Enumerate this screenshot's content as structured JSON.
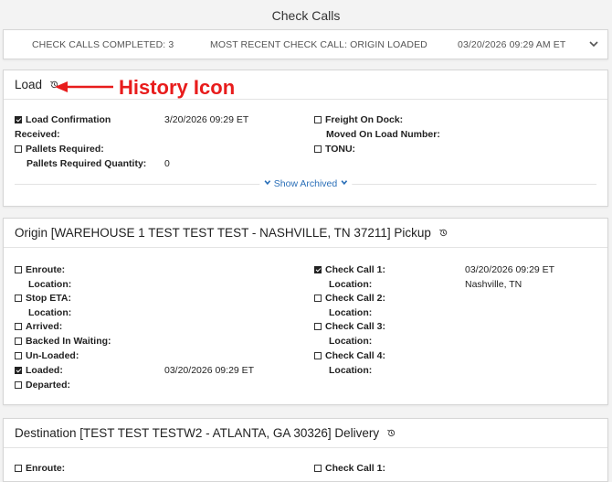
{
  "page": {
    "title": "Check Calls"
  },
  "summary": {
    "completed": "CHECK CALLS COMPLETED: 3",
    "recent": "MOST RECENT CHECK CALL: ORIGIN LOADED",
    "timestamp": "03/20/2026 09:29 AM ET"
  },
  "annotation": {
    "text": "History Icon",
    "color": "#e81c1c"
  },
  "load": {
    "title": "Load",
    "load_confirmation": "Load Confirmation",
    "received": "Received:",
    "load_confirmation_value": "3/20/2026 09:29 ET",
    "pallets_required": "Pallets Required:",
    "pallets_required_quantity": "Pallets Required Quantity:",
    "pallets_quantity_value": "0",
    "freight_on_dock": "Freight On Dock:",
    "moved_on_load_number": "Moved On Load Number:",
    "tonu": "TONU:",
    "show_archived": "Show Archived"
  },
  "origin": {
    "title": "Origin [WAREHOUSE 1 TEST TEST TEST - NASHVILLE, TN 37211] Pickup",
    "enroute": "Enroute:",
    "location": "Location:",
    "stop_eta": "Stop ETA:",
    "arrived": "Arrived:",
    "backed_in_waiting": "Backed In Waiting:",
    "un_loaded": "Un-Loaded:",
    "loaded": "Loaded:",
    "loaded_value": "03/20/2026 09:29 ET",
    "departed": "Departed:",
    "check_call_1": "Check Call 1:",
    "check_call_1_value": "03/20/2026 09:29 ET",
    "check_call_1_location": "Nashville, TN",
    "check_call_2": "Check Call 2:",
    "check_call_3": "Check Call 3:",
    "check_call_4": "Check Call 4:"
  },
  "destination": {
    "title": "Destination [TEST TEST TESTW2 - ATLANTA, GA 30326] Delivery",
    "enroute": "Enroute:",
    "check_call_1": "Check Call 1:"
  },
  "colors": {
    "link": "#2a6fb8",
    "annotation": "#e81c1c"
  }
}
